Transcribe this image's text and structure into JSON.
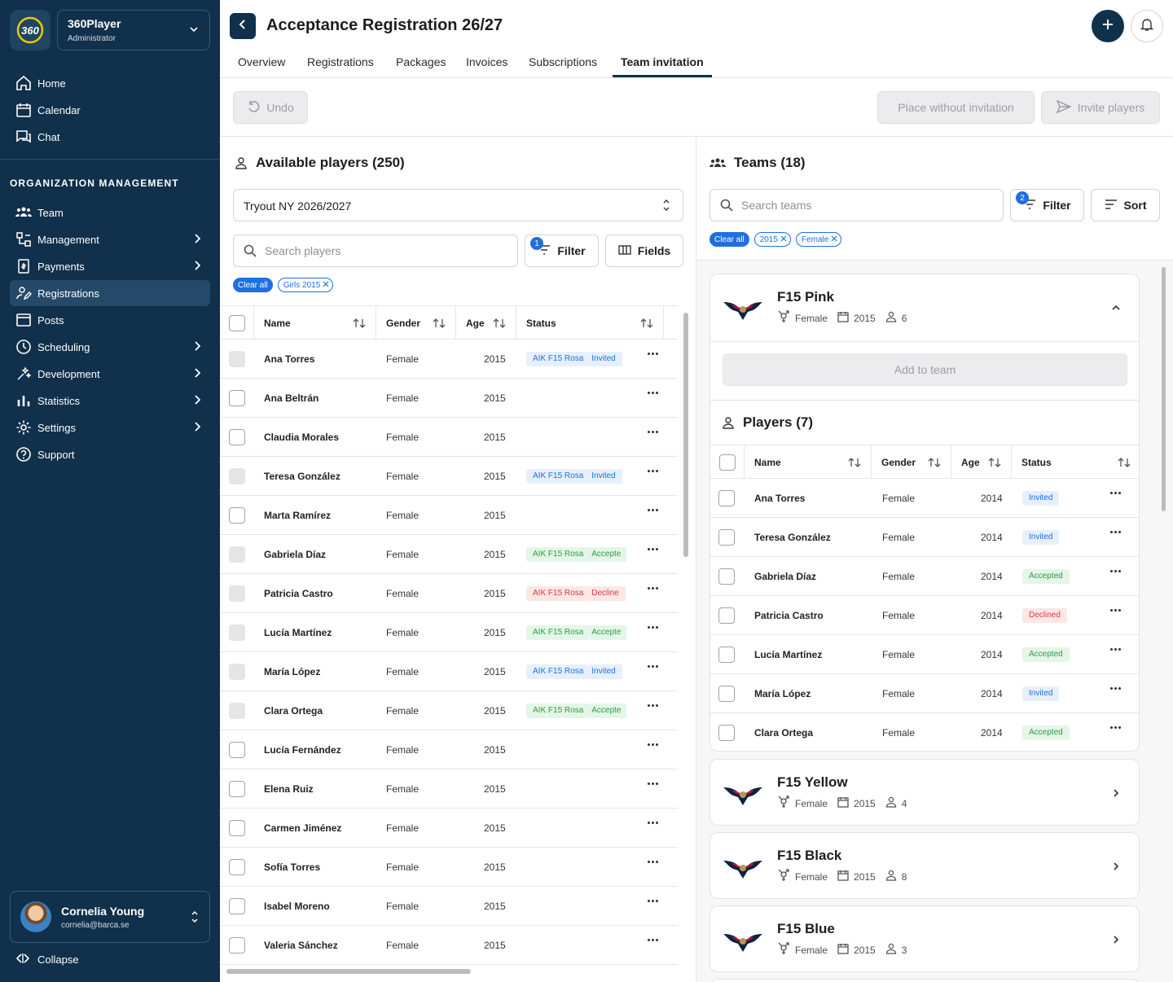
{
  "org": {
    "name": "360Player",
    "role": "Administrator",
    "logo_text": "360"
  },
  "nav": {
    "top": [
      {
        "label": "Home",
        "icon": "home-icon"
      },
      {
        "label": "Calendar",
        "icon": "calendar-icon"
      },
      {
        "label": "Chat",
        "icon": "chat-icon"
      }
    ],
    "section_title": "ORGANIZATION MANAGEMENT",
    "org_items": [
      {
        "label": "Team",
        "icon": "team-icon",
        "arrow": false
      },
      {
        "label": "Management",
        "icon": "management-icon",
        "arrow": true
      },
      {
        "label": "Payments",
        "icon": "payments-icon",
        "arrow": true
      },
      {
        "label": "Registrations",
        "icon": "registrations-icon",
        "arrow": false,
        "active": true
      },
      {
        "label": "Posts",
        "icon": "posts-icon",
        "arrow": false
      },
      {
        "label": "Scheduling",
        "icon": "scheduling-icon",
        "arrow": true
      },
      {
        "label": "Development",
        "icon": "development-icon",
        "arrow": true
      },
      {
        "label": "Statistics",
        "icon": "statistics-icon",
        "arrow": true
      },
      {
        "label": "Settings",
        "icon": "settings-icon",
        "arrow": true
      },
      {
        "label": "Support",
        "icon": "support-icon",
        "arrow": false
      }
    ]
  },
  "user": {
    "name": "Cornelia Young",
    "email": "cornelia@barca.se"
  },
  "collapse_label": "Collapse",
  "header": {
    "title": "Acceptance Registration 26/27"
  },
  "tabs": [
    "Overview",
    "Registrations",
    "Packages",
    "Invoices",
    "Subscriptions",
    "Team invitation"
  ],
  "toolbar": {
    "undo": "Undo",
    "place_without": "Place without invitation",
    "invite": "Invite players"
  },
  "available": {
    "title": "Available players (250)",
    "select_value": "Tryout NY 2026/2027",
    "search_placeholder": "Search players",
    "filter_label": "Filter",
    "filter_count": "1",
    "fields_label": "Fields",
    "clear_all": "Clear all",
    "chips": [
      "Girls 2015"
    ],
    "columns": [
      "Name",
      "Gender",
      "Age",
      "Status"
    ],
    "rows": [
      {
        "name": "Ana Torres",
        "gender": "Female",
        "age": "2015",
        "team": "AIK F15 Rosa",
        "status": "Invited",
        "tone": "blue",
        "disabled": true
      },
      {
        "name": "Ana Beltrán",
        "gender": "Female",
        "age": "2015",
        "team": "",
        "status": "",
        "tone": "",
        "disabled": false
      },
      {
        "name": "Claudia Morales",
        "gender": "Female",
        "age": "2015",
        "team": "",
        "status": "",
        "tone": "",
        "disabled": false
      },
      {
        "name": "Teresa González",
        "gender": "Female",
        "age": "2015",
        "team": "AIK F15 Rosa",
        "status": "Invited",
        "tone": "blue",
        "disabled": true
      },
      {
        "name": "Marta Ramírez",
        "gender": "Female",
        "age": "2015",
        "team": "",
        "status": "",
        "tone": "",
        "disabled": false
      },
      {
        "name": "Gabriela Díaz",
        "gender": "Female",
        "age": "2015",
        "team": "AIK F15 Rosa",
        "status": "Accepte",
        "tone": "green",
        "disabled": true
      },
      {
        "name": "Patricia Castro",
        "gender": "Female",
        "age": "2015",
        "team": "AIK F15 Rosa",
        "status": "Decline",
        "tone": "red",
        "disabled": true
      },
      {
        "name": "Lucía Martínez",
        "gender": "Female",
        "age": "2015",
        "team": "AIK F15 Rosa",
        "status": "Accepte",
        "tone": "green",
        "disabled": true
      },
      {
        "name": "María López",
        "gender": "Female",
        "age": "2015",
        "team": "AIK F15 Rosa",
        "status": "Invited",
        "tone": "blue",
        "disabled": true
      },
      {
        "name": "Clara Ortega",
        "gender": "Female",
        "age": "2015",
        "team": "AIK F15 Rosa",
        "status": "Accepte",
        "tone": "green",
        "disabled": true
      },
      {
        "name": "Lucía Fernández",
        "gender": "Female",
        "age": "2015",
        "team": "",
        "status": "",
        "tone": "",
        "disabled": false
      },
      {
        "name": "Elena Ruiz",
        "gender": "Female",
        "age": "2015",
        "team": "",
        "status": "",
        "tone": "",
        "disabled": false
      },
      {
        "name": "Carmen Jiménez",
        "gender": "Female",
        "age": "2015",
        "team": "",
        "status": "",
        "tone": "",
        "disabled": false
      },
      {
        "name": "Sofía Torres",
        "gender": "Female",
        "age": "2015",
        "team": "",
        "status": "",
        "tone": "",
        "disabled": false
      },
      {
        "name": "Isabel Moreno",
        "gender": "Female",
        "age": "2015",
        "team": "",
        "status": "",
        "tone": "",
        "disabled": false
      },
      {
        "name": "Valeria Sánchez",
        "gender": "Female",
        "age": "2015",
        "team": "",
        "status": "",
        "tone": "",
        "disabled": false
      }
    ]
  },
  "teams": {
    "title": "Teams (18)",
    "search_placeholder": "Search teams",
    "filter_label": "Filter",
    "filter_count": "2",
    "sort_label": "Sort",
    "clear_all": "Clear all",
    "chips": [
      "2015",
      "Female"
    ],
    "expanded": {
      "name": "F15 Pink",
      "gender": "Female",
      "year": "2015",
      "count": "6",
      "add_label": "Add to team",
      "players_title": "Players (7)",
      "columns": [
        "Name",
        "Gender",
        "Age",
        "Status"
      ],
      "players": [
        {
          "name": "Ana Torres",
          "gender": "Female",
          "age": "2014",
          "status": "Invited",
          "tone": "blue"
        },
        {
          "name": "Teresa González",
          "gender": "Female",
          "age": "2014",
          "status": "Invited",
          "tone": "blue"
        },
        {
          "name": "Gabriela Díaz",
          "gender": "Female",
          "age": "2014",
          "status": "Accepted",
          "tone": "green"
        },
        {
          "name": "Patricia Castro",
          "gender": "Female",
          "age": "2014",
          "status": "Declined",
          "tone": "red"
        },
        {
          "name": "Lucía Martínez",
          "gender": "Female",
          "age": "2014",
          "status": "Accepted",
          "tone": "green"
        },
        {
          "name": "María López",
          "gender": "Female",
          "age": "2014",
          "status": "Invited",
          "tone": "blue"
        },
        {
          "name": "Clara Ortega",
          "gender": "Female",
          "age": "2014",
          "status": "Accepted",
          "tone": "green"
        }
      ]
    },
    "collapsed": [
      {
        "name": "F15 Yellow",
        "gender": "Female",
        "year": "2015",
        "count": "4"
      },
      {
        "name": "F15 Black",
        "gender": "Female",
        "year": "2015",
        "count": "8"
      },
      {
        "name": "F15 Blue",
        "gender": "Female",
        "year": "2015",
        "count": "3"
      }
    ]
  }
}
